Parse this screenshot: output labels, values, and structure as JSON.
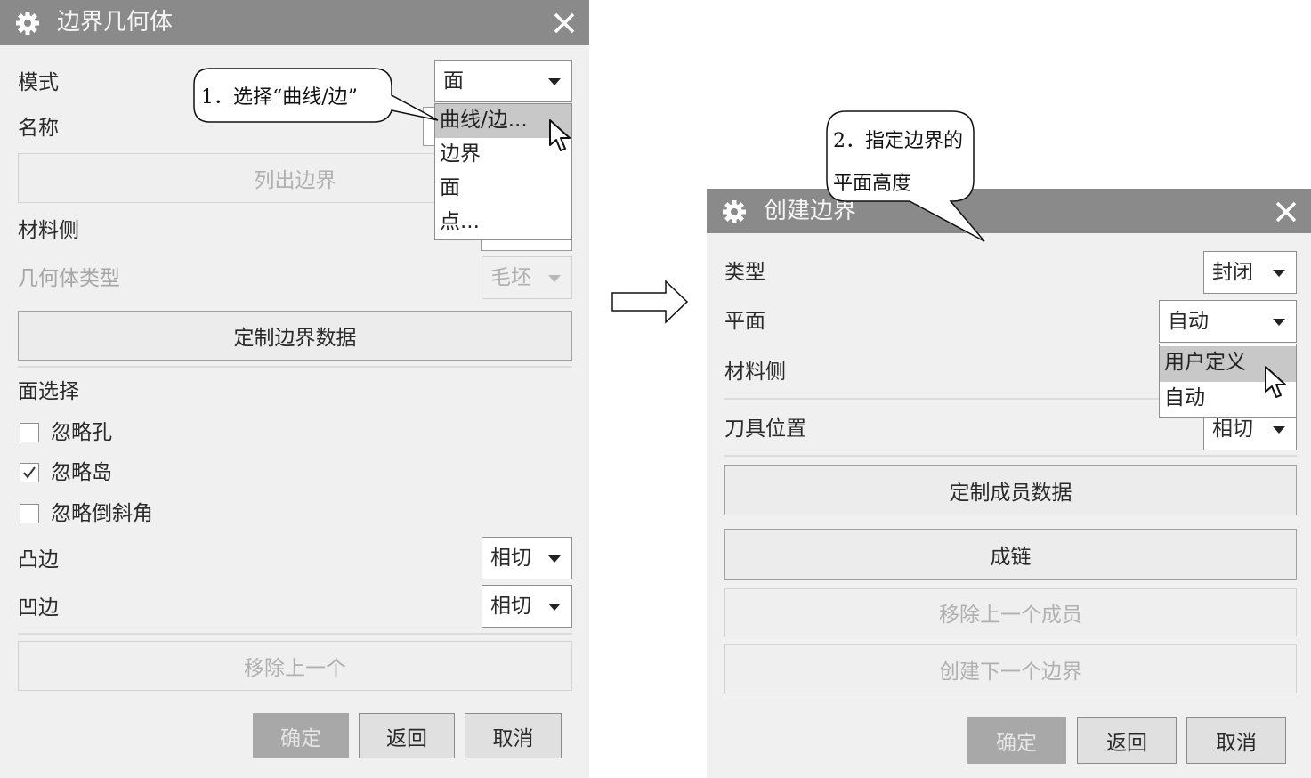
{
  "left_dialog": {
    "title": "边界几何体",
    "mode_label": "模式",
    "mode_value": "面",
    "name_label": "名称",
    "list_boundaries_button": "列出边界",
    "material_side_label": "材料侧",
    "geometry_type_label": "几何体类型",
    "geometry_type_value": "毛坯",
    "customize_button": "定制边界数据",
    "face_selection_label": "面选择",
    "checkboxes": [
      {
        "label": "忽略孔",
        "checked": false
      },
      {
        "label": "忽略岛",
        "checked": true
      },
      {
        "label": "忽略倒斜角",
        "checked": false
      }
    ],
    "convex_label": "凸边",
    "convex_value": "相切",
    "concave_label": "凹边",
    "concave_value": "相切",
    "remove_last_button": "移除上一个",
    "ok_button": "确定",
    "back_button": "返回",
    "cancel_button": "取消",
    "mode_menu": [
      "曲线/边...",
      "边界",
      "面",
      "点..."
    ],
    "mode_menu_highlighted": "曲线/边..."
  },
  "right_dialog": {
    "title": "创建边界",
    "type_label": "类型",
    "type_value": "封闭",
    "plane_label": "平面",
    "plane_value": "自动",
    "material_side_label": "材料侧",
    "tool_position_label": "刀具位置",
    "tool_position_value": "相切",
    "customize_member_button": "定制成员数据",
    "chain_button": "成链",
    "remove_last_member_button": "移除上一个成员",
    "create_next_boundary_button": "创建下一个边界",
    "ok_button": "确定",
    "back_button": "返回",
    "cancel_button": "取消",
    "plane_menu": [
      "用户定义",
      "自动"
    ],
    "plane_menu_highlighted": "用户定义"
  },
  "callouts": {
    "step1": "1．选择“曲线/边”",
    "step2_line1": "2．指定边界的",
    "step2_line2": "平面高度"
  },
  "arrow_icon": "right-arrow-icon",
  "colors": {
    "titlebar": "#8a8a8a",
    "dialog_bg": "#f0f0f0",
    "highlight": "#c8c8c8"
  }
}
